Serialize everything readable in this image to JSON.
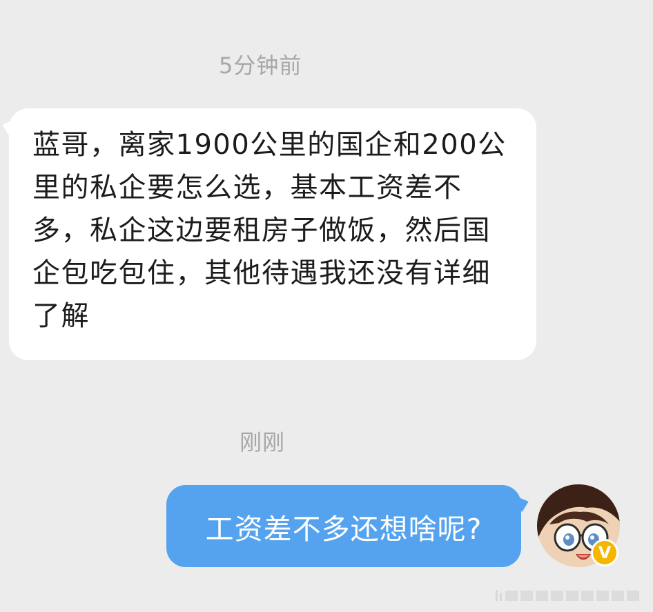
{
  "conversation": {
    "timestamp_1": "5分钟前",
    "incoming_message": "蓝哥，离家1900公里的国企和200公里的私企要怎么选，基本工资差不多，私企这边要租房子做饭，然后国企包吃包住，其他待遇我还没有详细了解",
    "timestamp_2": "刚刚",
    "outgoing_message": "工资差不多还想啥呢?"
  },
  "avatar": {
    "icon": "anime-character-avatar",
    "badge_icon": "verified-v-badge",
    "badge_label": "V"
  },
  "colors": {
    "background": "#ececec",
    "incoming_bubble": "#ffffff",
    "outgoing_bubble": "#55a3ee",
    "timestamp_text": "#a7a7a7",
    "badge": "#f6b500"
  }
}
